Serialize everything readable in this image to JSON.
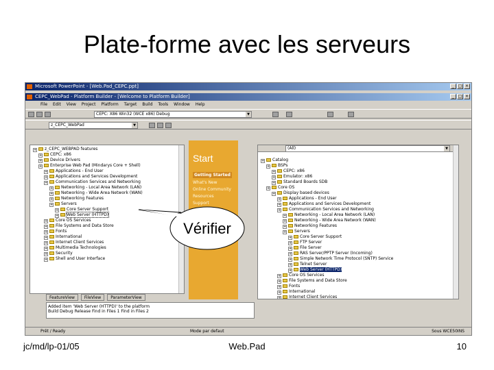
{
  "slide": {
    "title": "Plate-forme avec les serveurs",
    "callout": "Vérifier",
    "footer_left": "jc/md/lp-01/05",
    "footer_center": "Web.Pad",
    "page_number": "10"
  },
  "screenshot": {
    "outer_title": "Microsoft PowerPoint - [Web.Pad_CEPC.ppt]",
    "inner_title": "CEPC_WebPad - Platform Builder - [Welcome to Platform Builder]",
    "menu": [
      "File",
      "Edit",
      "View",
      "Project",
      "Platform",
      "Target",
      "Build",
      "Tools",
      "Window",
      "Help"
    ],
    "toolbar_combo": "CEPC: X86 Win32 (WCE x86) Debug",
    "project_combo": "z_CEPC_WebPad",
    "catalog_combo": "(All)",
    "left_tree_header": "",
    "left_tree": [
      "z_CEPC_WEBPAD features",
      "CEPC: x86",
      "Device Drivers",
      "Enterprise Web Pad (Mindarys Core + Shell)",
      "Applications - End User",
      "Applications and Services Development",
      "Communication Services and Networking",
      "Networking - Local Area Network (LAN)",
      "Networking - Wide Area Network (WAN)",
      "Networking Features",
      "Servers",
      "Core Server Support",
      "Web Server (HTTPD)",
      "Core OS Services",
      "File Systems and Data Store",
      "Fonts",
      "International",
      "Internet Client Services",
      "Multimedia Technologies",
      "Security",
      "Shell and User Interface"
    ],
    "start_panel": {
      "title": "Start",
      "links": [
        "Getting Started",
        "What's New",
        "Online Community",
        "Resources",
        "Support"
      ]
    },
    "right_tree": [
      "Catalog",
      "BSPs",
      "CEPC: x86",
      "Emulator: x86",
      "Standard Boards SDB",
      "Core OS",
      "Display based devices",
      "Applications - End User",
      "Applications and Services Development",
      "Communication Services and Networking",
      "Networking - Local Area Network (LAN)",
      "Networking - Wide Area Network (WAN)",
      "Networking Features",
      "Servers",
      "Core Server Support",
      "FTP Server",
      "File Server",
      "RAS Server/PPTP Server (Incoming)",
      "Simple Network Time Protocol (SNTP) Service",
      "Telnet Server",
      "Web Server (HTTPD)",
      "Core OS Services",
      "File Systems and Data Store",
      "Fonts",
      "International",
      "Internet Client Services"
    ],
    "tabs": [
      "FeatureView",
      "FileView",
      "ParameterView"
    ],
    "output_lines": [
      "Added item 'Web Server (HTTPD)' to the platform",
      "Build Debug Release Find in Files 1 Find in Files 2"
    ],
    "status_left": "Prêt / Ready",
    "status_mode": "Mode par defaut",
    "status_right": "Sous WCE50INS"
  }
}
